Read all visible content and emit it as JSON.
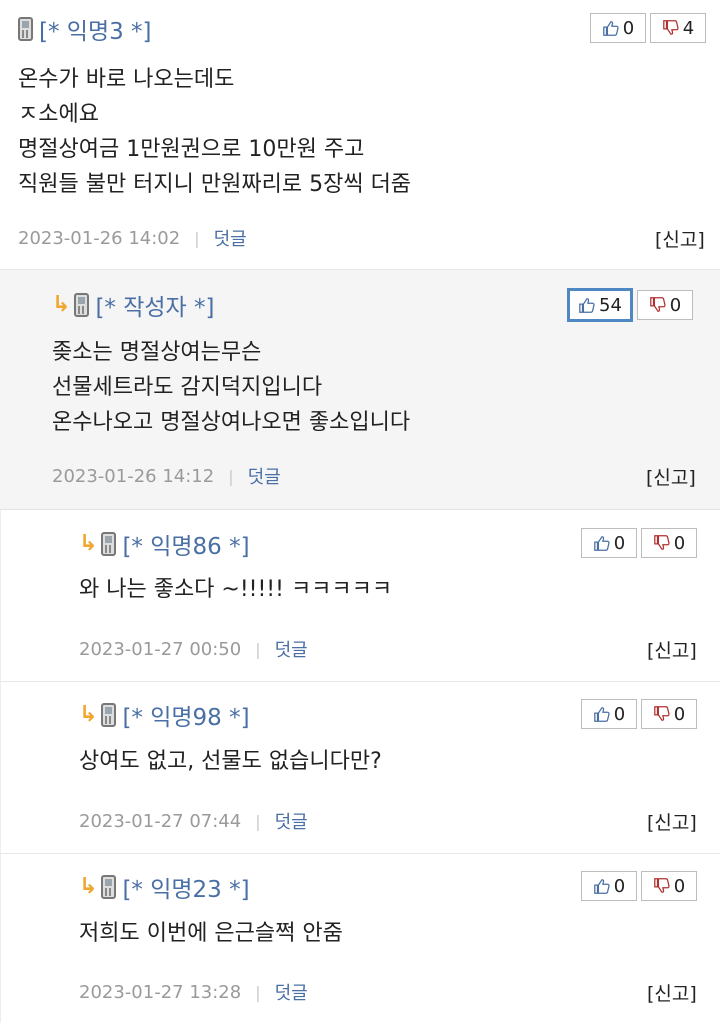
{
  "comments": [
    {
      "author": "[* 익명3 *]",
      "up": "0",
      "down": "4",
      "lines": [
        "온수가 바로 나오는데도",
        "ㅈ소에요",
        "명절상여금 1만원권으로 10만원 주고",
        "직원들 불만 터지니 만원짜리로 5장씩 더줌"
      ],
      "date": "2023-01-26 14:02",
      "reply_label": "덧글",
      "report_label": "[신고]"
    },
    {
      "author": "[* 작성자 *]",
      "up": "54",
      "down": "0",
      "lines": [
        "좆소는 명절상여는무슨",
        "선물세트라도 감지덕지입니다",
        "온수나오고 명절상여나오면 좋소입니다"
      ],
      "date": "2023-01-26 14:12",
      "reply_label": "덧글",
      "report_label": "[신고]"
    },
    {
      "author": "[* 익명86 *]",
      "up": "0",
      "down": "0",
      "lines": [
        "와 나는 좋소다 ~!!!!! ㅋㅋㅋㅋㅋ"
      ],
      "date": "2023-01-27 00:50",
      "reply_label": "덧글",
      "report_label": "[신고]"
    },
    {
      "author": "[* 익명98 *]",
      "up": "0",
      "down": "0",
      "lines": [
        "상여도 없고, 선물도 없습니다만?"
      ],
      "date": "2023-01-27 07:44",
      "reply_label": "덧글",
      "report_label": "[신고]"
    },
    {
      "author": "[* 익명23 *]",
      "up": "0",
      "down": "0",
      "lines": [
        "저희도 이번에 은근슬쩍 안줌"
      ],
      "date": "2023-01-27 13:28",
      "reply_label": "덧글",
      "report_label": "[신고]"
    }
  ]
}
